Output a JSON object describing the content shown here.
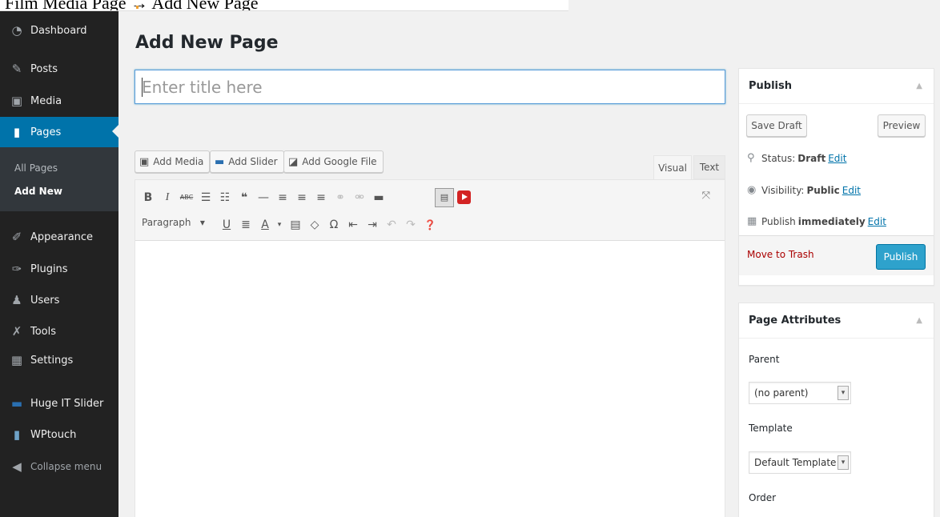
{
  "caption": "Film Media Page → Add New Page",
  "sidebar": {
    "items": [
      {
        "label": "Dashboard",
        "icon": "dashboard-icon"
      },
      {
        "label": "Posts",
        "icon": "pin-icon"
      },
      {
        "label": "Media",
        "icon": "media-icon"
      },
      {
        "label": "Pages",
        "icon": "pages-icon"
      },
      {
        "label": "Appearance",
        "icon": "brush-icon"
      },
      {
        "label": "Plugins",
        "icon": "plug-icon"
      },
      {
        "label": "Users",
        "icon": "users-icon"
      },
      {
        "label": "Tools",
        "icon": "wrench-icon"
      },
      {
        "label": "Settings",
        "icon": "settings-icon"
      },
      {
        "label": "Huge IT Slider",
        "icon": "slider-icon"
      },
      {
        "label": "WPtouch",
        "icon": "phone-icon"
      }
    ],
    "submenu": [
      "All Pages",
      "Add New"
    ],
    "collapse": "Collapse menu"
  },
  "main": {
    "title": "Add New Page",
    "title_placeholder": "Enter title here",
    "media_buttons": [
      "Add Media",
      "Add Slider",
      "Add Google File"
    ],
    "tabs": [
      "Visual",
      "Text"
    ],
    "format_select": "Paragraph"
  },
  "publish": {
    "heading": "Publish",
    "save_draft": "Save Draft",
    "preview": "Preview",
    "status_label": "Status:",
    "status_value": "Draft",
    "visibility_label": "Visibility:",
    "visibility_value": "Public",
    "schedule_label": "Publish",
    "schedule_value": "immediately",
    "edit": "Edit",
    "trash": "Move to Trash",
    "publish_button": "Publish"
  },
  "attributes": {
    "heading": "Page Attributes",
    "parent_label": "Parent",
    "parent_value": "(no parent)",
    "template_label": "Template",
    "template_value": "Default Template",
    "order_label": "Order"
  },
  "colors": {
    "sidebar": "#222222",
    "accent": "#0073aa",
    "publish_button": "#2ea2cc",
    "trash": "#aa0000"
  }
}
